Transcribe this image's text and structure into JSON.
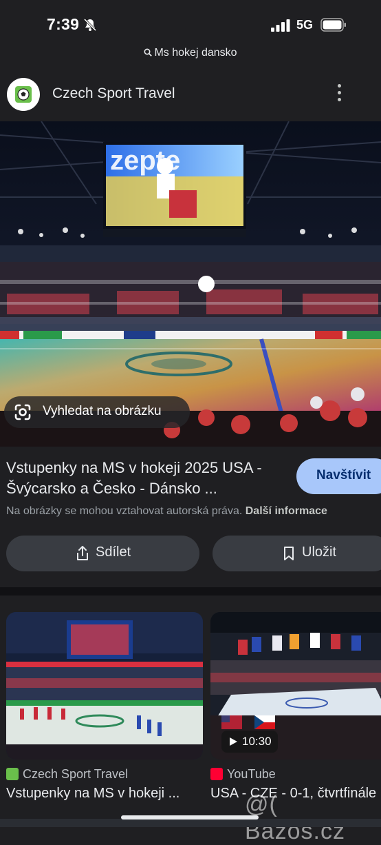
{
  "status_bar": {
    "time": "7:39",
    "network": "5G"
  },
  "search": {
    "query": "Ms hokej dansko"
  },
  "source": {
    "name": "Czech Sport Travel"
  },
  "hero": {
    "lens_label": "Vyhledat na obrázku"
  },
  "result": {
    "title": "Vstupenky na MS v hokeji 2025 USA - Švýcarsko a Česko - Dánsko ...",
    "visit_label": "Navštívit",
    "copyright_text": "Na obrázky se mohou vztahovat autorská práva.",
    "more_info_label": "Další informace"
  },
  "actions": {
    "share_label": "Sdílet",
    "save_label": "Uložit"
  },
  "related": [
    {
      "source": "Czech Sport Travel",
      "title": "Vstupenky na MS v hokeji ..."
    },
    {
      "source": "YouTube",
      "title": "USA - CZE - 0-1, čtvrtfinále",
      "duration": "10:30"
    }
  ],
  "watermark": "@( Bazos.cz",
  "colors": {
    "accent": "#a8c7fa",
    "background": "#1f1f22",
    "chip": "#393c42"
  }
}
